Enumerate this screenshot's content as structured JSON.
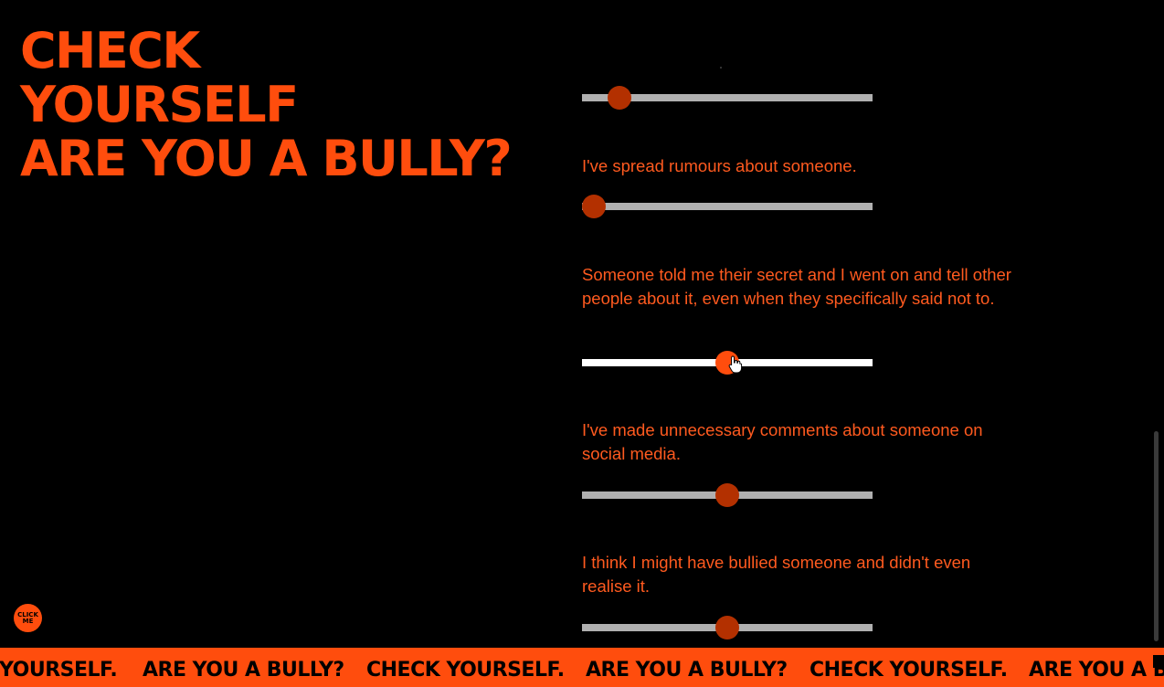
{
  "title": {
    "line1": "CHECK",
    "line2": "YOURSELF",
    "line3": "ARE YOU A BULLY?"
  },
  "questions": [
    {
      "text": "",
      "value_percent": 13
    },
    {
      "text": "I've spread rumours about someone.",
      "value_percent": 4
    },
    {
      "text": "Someone told me their secret and I went on and tell other people about it, even when they specifically said not to.",
      "value_percent": 50,
      "active": true
    },
    {
      "text": "I've made unnecessary comments about someone on social media.",
      "value_percent": 50
    },
    {
      "text": "I think I might have bullied someone and didn't even realise it.",
      "value_percent": 50
    }
  ],
  "click_me_label": "CLICK ME",
  "ticker": {
    "items": [
      "YOURSELF.",
      "ARE YOU A BULLY?",
      "CHECK YOURSELF.",
      "ARE YOU A BULLY?",
      "CHECK YOURSELF.",
      "ARE YOU A B"
    ]
  },
  "colors": {
    "accent": "#ff4d0d",
    "background": "#000000",
    "thumb_inactive": "#b33000",
    "track": "#b0b0b0"
  }
}
